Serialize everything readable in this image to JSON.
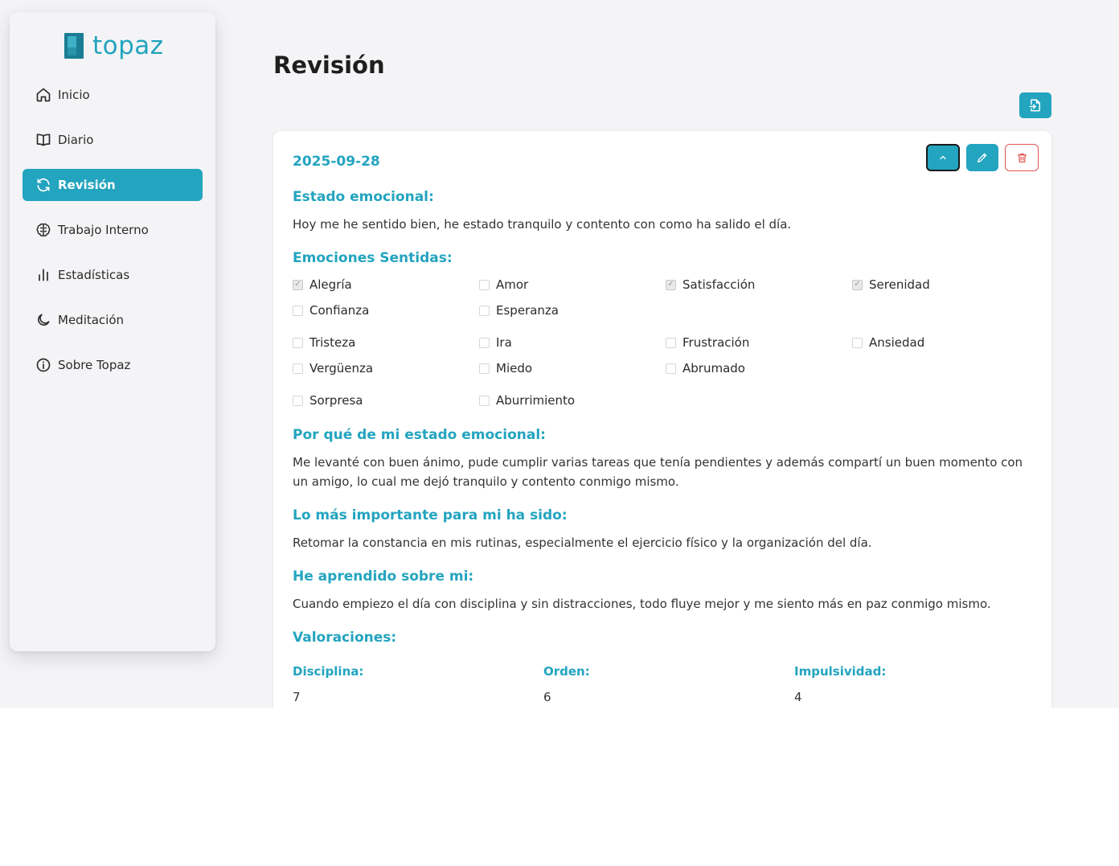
{
  "brand": {
    "name": "topaz"
  },
  "sidebar": {
    "items": [
      {
        "label": "Inicio",
        "icon": "home-icon",
        "active": false
      },
      {
        "label": "Diario",
        "icon": "book-icon",
        "active": false
      },
      {
        "label": "Revisión",
        "icon": "refresh-icon",
        "active": true
      },
      {
        "label": "Trabajo Interno",
        "icon": "brain-icon",
        "active": false
      },
      {
        "label": "Estadísticas",
        "icon": "bar-chart-icon",
        "active": false
      },
      {
        "label": "Meditación",
        "icon": "moon-icon",
        "active": false
      },
      {
        "label": "Sobre Topaz",
        "icon": "info-icon",
        "active": false
      }
    ]
  },
  "page": {
    "title": "Revisión",
    "export_icon": "file-import-icon"
  },
  "entry": {
    "date": "2025-09-28",
    "actions": {
      "collapse_icon": "chevron-up-icon",
      "edit_icon": "pencil-icon",
      "delete_icon": "trash-icon"
    },
    "estado_title": "Estado emocional:",
    "estado_text": "Hoy me he sentido bien, he estado tranquilo y contento con como ha salido el día.",
    "emociones_title": "Emociones Sentidas:",
    "emotions": [
      {
        "label": "Alegría",
        "checked": true
      },
      {
        "label": "Amor",
        "checked": false
      },
      {
        "label": "Satisfacción",
        "checked": true
      },
      {
        "label": "Serenidad",
        "checked": true
      },
      {
        "label": "Confianza",
        "checked": false
      },
      {
        "label": "Esperanza",
        "checked": false
      },
      {
        "label": "Tristeza",
        "checked": false
      },
      {
        "label": "Ira",
        "checked": false
      },
      {
        "label": "Frustración",
        "checked": false
      },
      {
        "label": "Ansiedad",
        "checked": false
      },
      {
        "label": "Vergüenza",
        "checked": false
      },
      {
        "label": "Miedo",
        "checked": false
      },
      {
        "label": "Abrumado",
        "checked": false
      },
      {
        "label": "Sorpresa",
        "checked": false
      },
      {
        "label": "Aburrimiento",
        "checked": false
      }
    ],
    "porque_title": "Por qué de mi estado emocional:",
    "porque_text": "Me levanté con buen ánimo, pude cumplir varias tareas que tenía pendientes y además compartí un buen momento con un amigo, lo cual me dejó tranquilo y contento conmigo mismo.",
    "importante_title": "Lo más importante para mi ha sido:",
    "importante_text": "Retomar la constancia en mis rutinas, especialmente el ejercicio físico y la organización del día.",
    "aprendido_title": "He aprendido sobre mi:",
    "aprendido_text": "Cuando empiezo el día con disciplina y sin distracciones, todo fluye mejor y me siento más en paz conmigo mismo.",
    "valoraciones_title": "Valoraciones:",
    "ratings": [
      {
        "label": "Disciplina:",
        "value": "7"
      },
      {
        "label": "Orden:",
        "value": "6"
      },
      {
        "label": "Impulsividad:",
        "value": "4"
      }
    ]
  },
  "colors": {
    "accent": "#23a4bf",
    "danger": "#e25555",
    "background": "#f4f4f6"
  }
}
